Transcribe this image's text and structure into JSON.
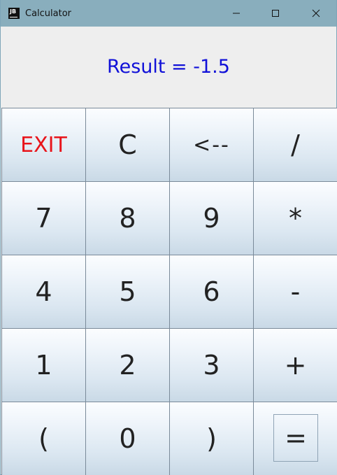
{
  "window": {
    "title": "Calculator",
    "icon_text": "JB",
    "controls": {
      "minimize": "minimize-icon",
      "maximize": "maximize-icon",
      "close": "close-icon"
    }
  },
  "display": {
    "result_text": "Result = -1.5"
  },
  "keypad": {
    "rows": [
      [
        "EXIT",
        "C",
        "<--",
        "/"
      ],
      [
        "7",
        "8",
        "9",
        "*"
      ],
      [
        "4",
        "5",
        "6",
        "-"
      ],
      [
        "1",
        "2",
        "3",
        "+"
      ],
      [
        "(",
        "0",
        ")",
        "="
      ]
    ]
  },
  "colors": {
    "titlebar": "#89aebd",
    "result_text": "#1010d8",
    "exit_text": "#e8141b",
    "key_text": "#222222"
  }
}
